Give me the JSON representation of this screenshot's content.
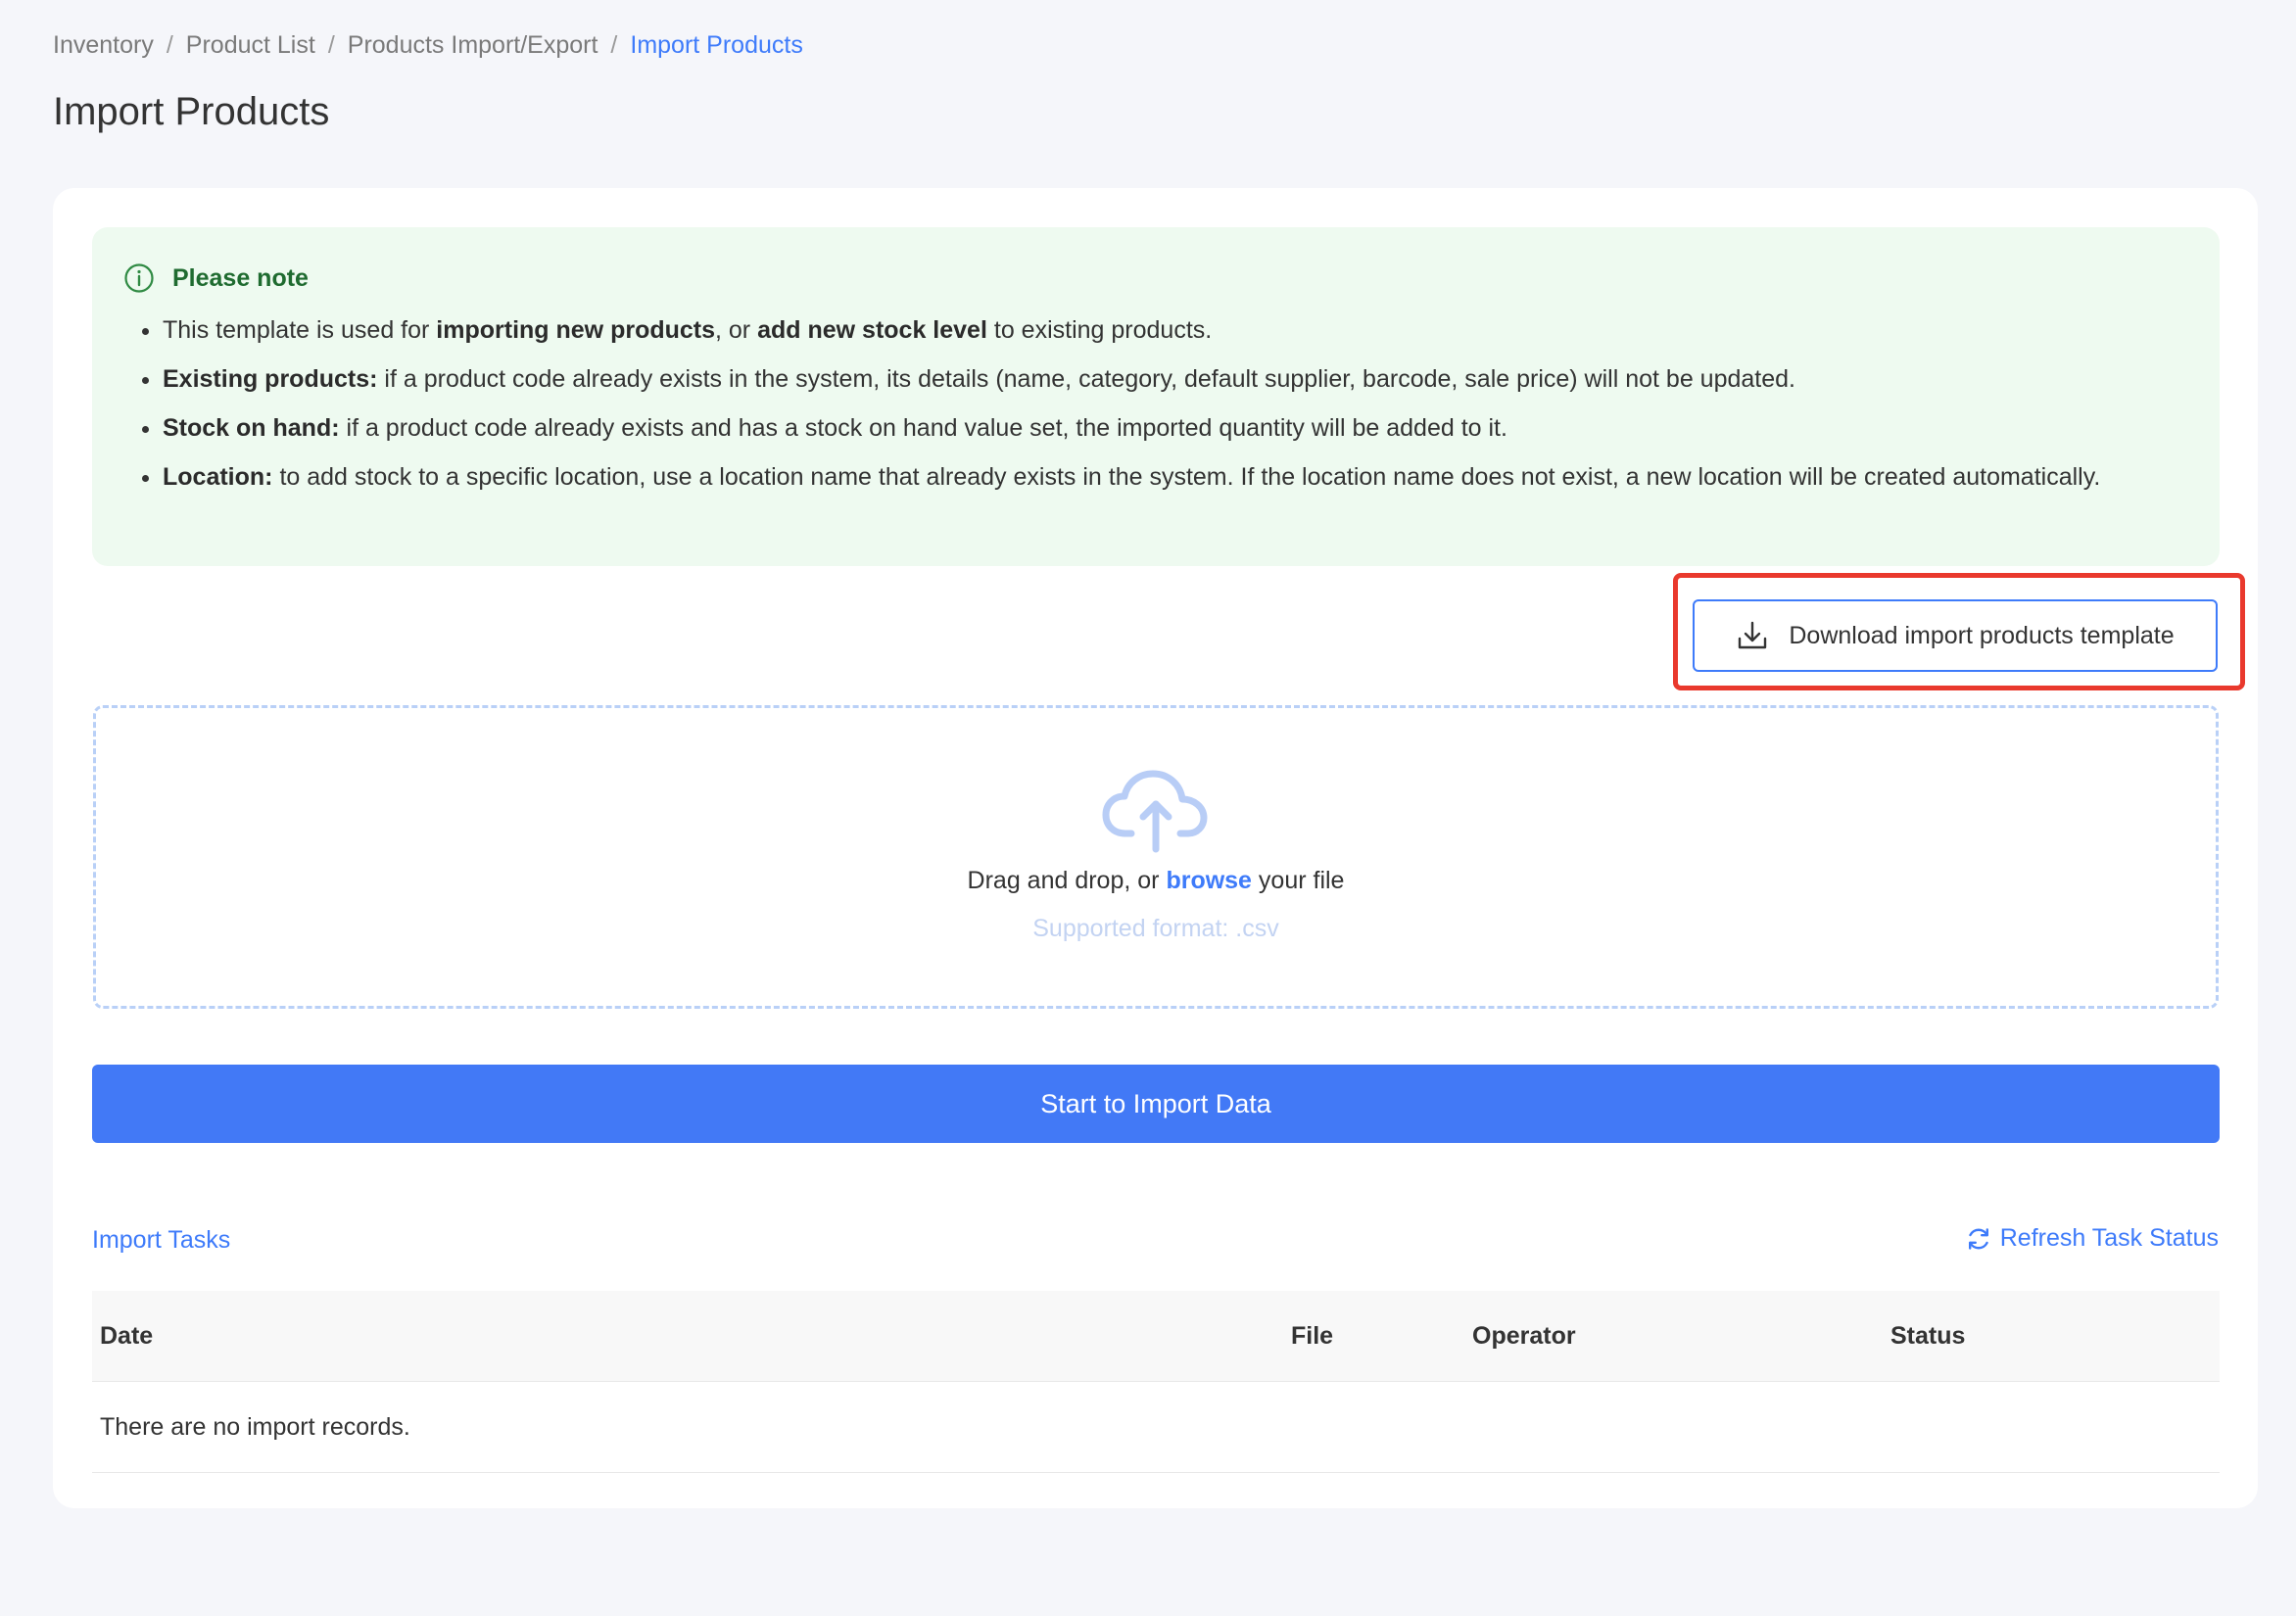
{
  "breadcrumb": [
    "Inventory",
    "Product List",
    "Products Import/Export",
    "Import Products"
  ],
  "breadcrumb_separator": "/",
  "page_title": "Import Products",
  "note": {
    "title": "Please note",
    "icon": "info-circle-icon",
    "items": [
      {
        "parts": [
          {
            "t": "This template is used for "
          },
          {
            "t": "importing new products",
            "b": true
          },
          {
            "t": ", or "
          },
          {
            "t": "add new stock level",
            "b": true
          },
          {
            "t": " to existing products."
          }
        ]
      },
      {
        "parts": [
          {
            "t": "Existing products:",
            "b": true
          },
          {
            "t": " if a product code already exists in the system, its details (name, category, default supplier, barcode, sale price) will not be updated."
          }
        ]
      },
      {
        "parts": [
          {
            "t": "Stock on hand:",
            "b": true
          },
          {
            "t": " if a product code already exists and has a stock on hand value set, the imported quantity will be added to it."
          }
        ]
      },
      {
        "parts": [
          {
            "t": "Location:",
            "b": true
          },
          {
            "t": " to add stock to a specific location, use a location name that already exists in the system. If the location name does not exist, a new location will be created automatically."
          }
        ]
      }
    ]
  },
  "download_button": {
    "label": "Download import products template",
    "icon": "download-icon"
  },
  "dropzone": {
    "icon": "cloud-upload-icon",
    "text_before": "Drag and drop, or ",
    "browse": "browse",
    "text_after": " your file",
    "format": "Supported format: .csv"
  },
  "import_button": "Start to Import Data",
  "tasks": {
    "title": "Import Tasks",
    "refresh": "Refresh Task Status",
    "columns": [
      "Date",
      "File",
      "Operator",
      "Status"
    ],
    "empty": "There are no import records."
  },
  "colors": {
    "accent": "#3e7bfa",
    "note_bg": "#eefaf0",
    "note_title": "#1f6b30",
    "highlight": "#e9392d"
  }
}
